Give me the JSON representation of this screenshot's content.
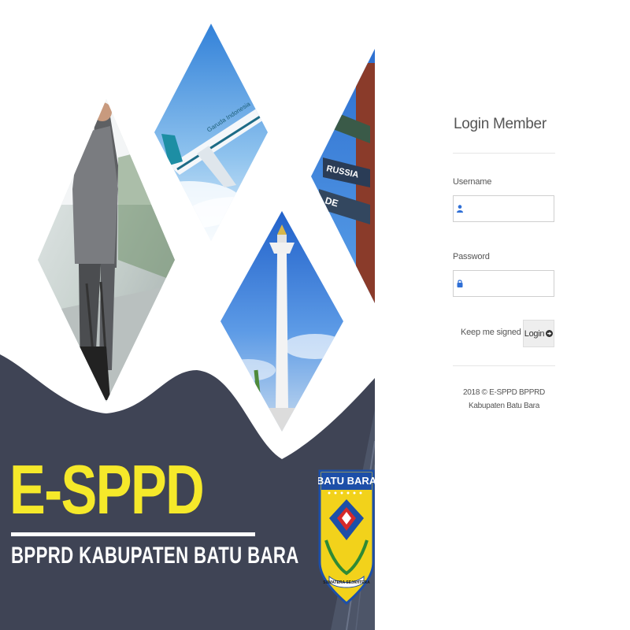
{
  "banner": {
    "app_name": "E-SPPD",
    "subtitle": "BPPRD KABUPATEN BATU BARA",
    "crest_title": "BATU BARA",
    "crest_motto": "SUMATERA SEJAHTERA",
    "plane_livery": "Garuda Indonesia",
    "sign_texts": [
      "RUSSIA",
      "DE"
    ]
  },
  "login": {
    "title": "Login Member",
    "username_label": "Username",
    "username_value": "",
    "password_label": "Password",
    "password_value": "",
    "remember_label": "Keep me signed in",
    "submit_label": "Login",
    "footer": "2018 © E-SPPD BPPRD Kabupaten Batu Bara"
  },
  "icons": {
    "username": "user-icon",
    "password": "lock-icon",
    "submit": "arrow-circle-right-icon"
  },
  "colors": {
    "banner_dark": "#3f4455",
    "brand_yellow": "#f5e92a",
    "field_icon_blue": "#2f6fd6",
    "button_bg": "#eeeeee"
  }
}
